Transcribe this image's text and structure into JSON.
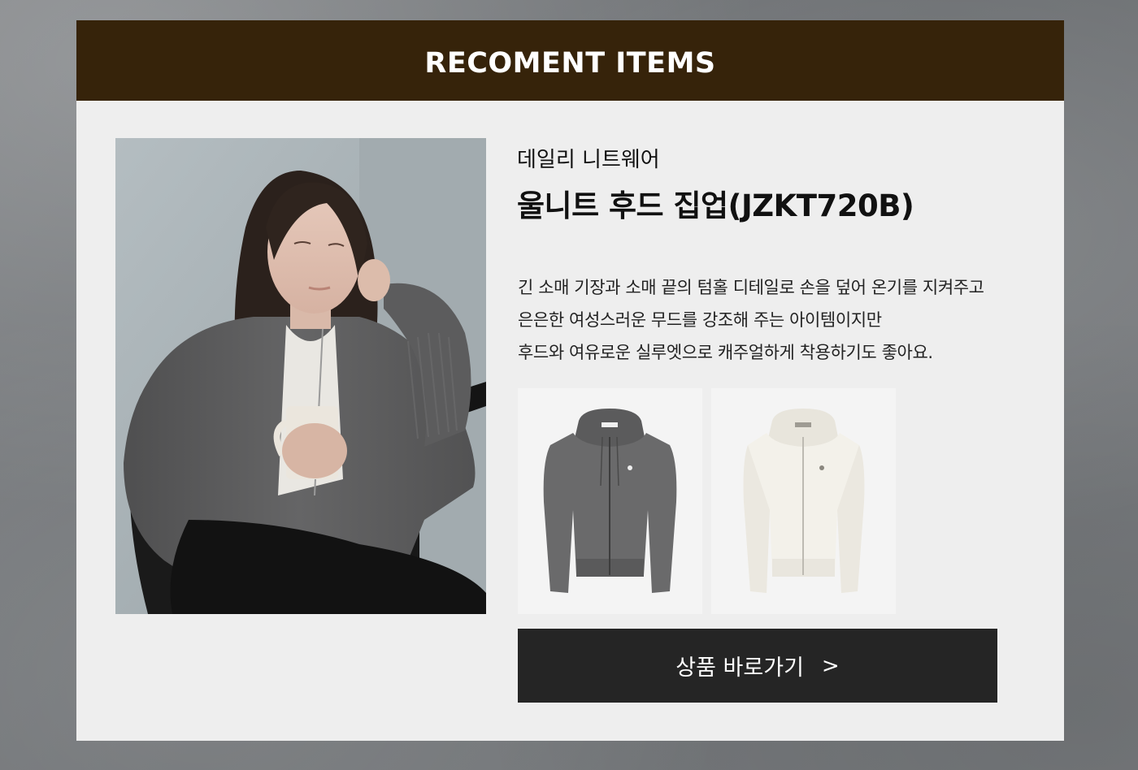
{
  "header": {
    "title": "RECOMENT ITEMS"
  },
  "product": {
    "category": "데일리 니트웨어",
    "name": "울니트 후드 집업(JZKT720B)",
    "description_lines": [
      "긴 소매 기장과 소매 끝의 텀홀 디테일로 손을 덮어 온기를 지켜주고",
      "은은한 여성스러운 무드를 강조해 주는 아이템이지만",
      "후드와 여유로운 실루엣으로 캐주얼하게 착용하기도 좋아요."
    ],
    "color_options": [
      "gray",
      "white"
    ]
  },
  "button": {
    "label": "상품 바로가기",
    "arrow": ">"
  },
  "colors": {
    "header_bg": "#36230a",
    "card_bg": "#eeeeee",
    "button_bg": "#252525",
    "page_bg": "#737679"
  },
  "icons": {
    "button_arrow": "chevron-right-icon"
  }
}
